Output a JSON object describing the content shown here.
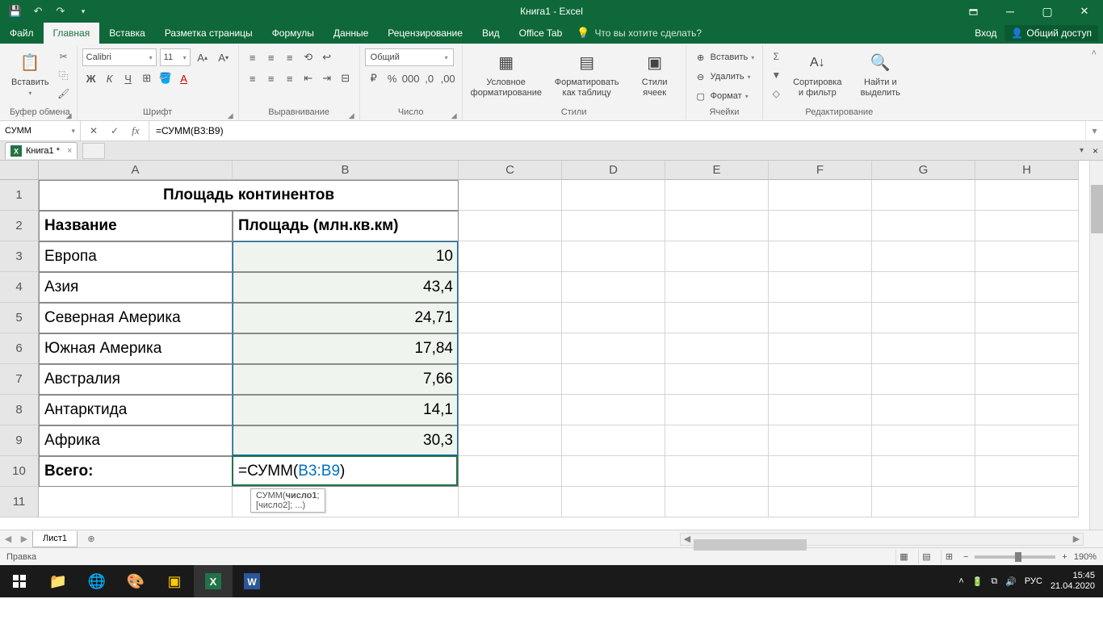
{
  "titlebar": {
    "title": "Книга1 - Excel"
  },
  "tabs": {
    "file": "Файл",
    "home": "Главная",
    "insert": "Вставка",
    "layout": "Разметка страницы",
    "formulas": "Формулы",
    "data": "Данные",
    "review": "Рецензирование",
    "view": "Вид",
    "officetab": "Office Tab",
    "tellme": "Что вы хотите сделать?",
    "login": "Вход",
    "share": "Общий доступ"
  },
  "ribbon": {
    "clipboard": {
      "label": "Буфер обмена",
      "paste": "Вставить"
    },
    "font": {
      "label": "Шрифт",
      "name": "Calibri",
      "size": "11"
    },
    "align": {
      "label": "Выравнивание"
    },
    "number": {
      "label": "Число",
      "format": "Общий"
    },
    "styles": {
      "label": "Стили",
      "cond": "Условное форматирование",
      "table": "Форматировать как таблицу",
      "cell": "Стили ячеек"
    },
    "cells": {
      "label": "Ячейки",
      "insert": "Вставить",
      "delete": "Удалить",
      "format": "Формат"
    },
    "editing": {
      "label": "Редактирование",
      "sort": "Сортировка и фильтр",
      "find": "Найти и выделить"
    }
  },
  "formulabar": {
    "namebox": "СУММ",
    "formula": "=СУММ(B3:B9)"
  },
  "doctab": {
    "name": "Книга1 *"
  },
  "grid": {
    "colwidths": {
      "A": 240,
      "B": 280,
      "C": 128,
      "D": 128,
      "E": 128,
      "F": 128,
      "G": 128,
      "H": 128
    },
    "columns": [
      "A",
      "B",
      "C",
      "D",
      "E",
      "F",
      "G",
      "H"
    ],
    "rows": [
      "1",
      "2",
      "3",
      "4",
      "5",
      "6",
      "7",
      "8",
      "9",
      "10",
      "11"
    ],
    "title": "Площадь континентов",
    "hdr_name": "Название",
    "hdr_area": "Площадь (млн.кв.км)",
    "data": [
      {
        "name": "Европа",
        "area": "10"
      },
      {
        "name": "Азия",
        "area": "43,4"
      },
      {
        "name": "Северная Америка",
        "area": "24,71"
      },
      {
        "name": "Южная Америка",
        "area": "17,84"
      },
      {
        "name": "Австралия",
        "area": "7,66"
      },
      {
        "name": "Антарктида",
        "area": "14,1"
      },
      {
        "name": "Африка",
        "area": "30,3"
      }
    ],
    "total_label": "Всего:",
    "total_formula_prefix": "=СУММ(",
    "total_formula_range": "B3:B9",
    "total_formula_suffix": ")",
    "tooltip": {
      "fn": "СУММ(",
      "arg1": "число1",
      "rest": "; [число2]; ...)"
    }
  },
  "sheet": {
    "name": "Лист1"
  },
  "status": {
    "mode": "Правка",
    "zoom": "190%"
  },
  "taskbar": {
    "lang": "РУС",
    "time": "15:45",
    "date": "21.04.2020"
  }
}
